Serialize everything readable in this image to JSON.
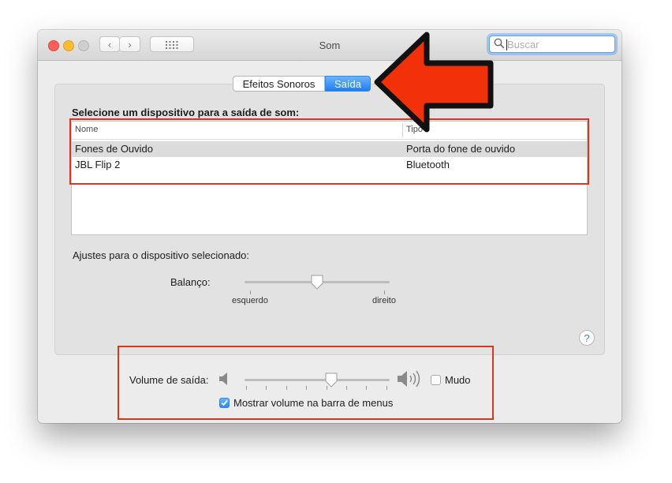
{
  "window": {
    "title": "Som"
  },
  "toolbar": {
    "back_glyph": "‹",
    "forward_glyph": "›"
  },
  "search": {
    "placeholder": "Buscar"
  },
  "tabs": [
    {
      "label": "Efeitos Sonoros",
      "selected": false
    },
    {
      "label": "Saída",
      "selected": true
    }
  ],
  "output": {
    "heading": "Selecione um dispositivo para a saída de som:",
    "columns": [
      "Nome",
      "Tipo"
    ],
    "devices": [
      {
        "name": "Fones de Ouvido",
        "type": "Porta do fone de ouvido",
        "selected": true
      },
      {
        "name": "JBL Flip 2",
        "type": "Bluetooth",
        "selected": false
      }
    ]
  },
  "settings": {
    "heading": "Ajustes para o dispositivo selecionado:",
    "balance_label": "Balanço:",
    "balance_left": "esquerdo",
    "balance_right": "direito",
    "balance_value": 0.5
  },
  "help": {
    "glyph": "?"
  },
  "volume": {
    "label": "Volume de saída:",
    "value": 0.6,
    "mute_label": "Mudo",
    "mute_checked": false,
    "show_in_menu_label": "Mostrar volume na barra de menus",
    "show_in_menu_checked": true
  },
  "annotations": {
    "highlight_color": "#d9361a",
    "arrow_color": "#f2300a"
  },
  "colors": {
    "accent": "#2c86f2",
    "selection_row": "#dcdcdc"
  }
}
